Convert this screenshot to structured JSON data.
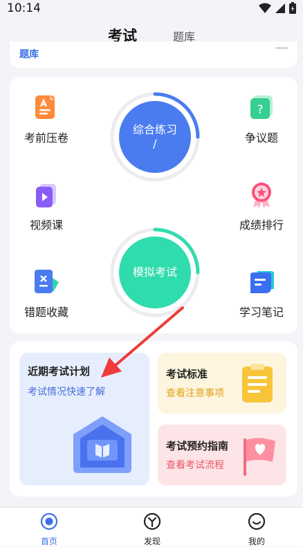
{
  "status_bar": {
    "time": "10:14"
  },
  "header": {
    "tabs": [
      {
        "label": "考试"
      },
      {
        "label": "题库"
      }
    ]
  },
  "top_card": {
    "label": "题库"
  },
  "features": {
    "pre_exam": "考前压卷",
    "disputed": "争议题",
    "comprehensive": "综合练习",
    "comprehensive_sub": "/",
    "video": "视频课",
    "ranking": "成绩排行",
    "mock": "模拟考试",
    "mistakes": "错题收藏",
    "notes": "学习笔记",
    "disputed_icon_glyph": "?"
  },
  "plan": {
    "recent": {
      "title": "近期考试计划",
      "subtitle": "考试情况快速了解"
    },
    "standard": {
      "title": "考试标准",
      "subtitle": "查看注意事项"
    },
    "appointment": {
      "title": "考试预约指南",
      "subtitle": "查看考试流程"
    }
  },
  "bottom_nav": [
    {
      "label": "首页",
      "active": true
    },
    {
      "label": "发现",
      "active": false
    },
    {
      "label": "我的",
      "active": false
    }
  ],
  "colors": {
    "accent_blue": "#4a7cf0",
    "accent_green": "#2fdcad",
    "nav_active": "#3d6fe8",
    "arrow_red": "#ee3a3a"
  }
}
